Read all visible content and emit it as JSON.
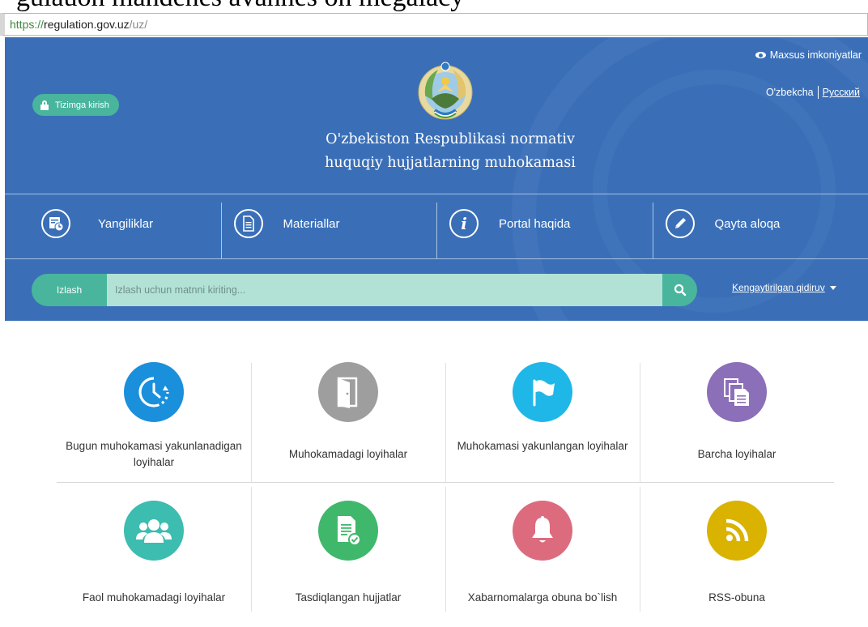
{
  "browser": {
    "partial_title": "guiauon mandenes avannes on megalacy",
    "url_proto": "https://",
    "url_host": "regulation.gov.uz",
    "url_path": "/uz/"
  },
  "header": {
    "login_label": "Tizimga kirish",
    "accessibility_label": "Maxsus imkoniyatlar",
    "lang_uz": "O'zbekcha",
    "lang_ru": "Русский",
    "title_line1": "O'zbekiston Respublikasi normativ",
    "title_line2": "huquqiy hujjatlarning muhokamasi"
  },
  "nav": [
    {
      "label": "Yangiliklar",
      "icon": "news-calendar-icon"
    },
    {
      "label": "Materiallar",
      "icon": "document-icon"
    },
    {
      "label": "Portal haqida",
      "icon": "info-icon"
    },
    {
      "label": "Qayta aloqa",
      "icon": "pencil-icon"
    }
  ],
  "search": {
    "label": "Izlash",
    "placeholder": "Izlash uchun matnni kiriting...",
    "advanced_label": "Kengaytirilgan qidiruv"
  },
  "tiles": [
    {
      "label": "Bugun muhokamasi yakunlanadigan loyihalar",
      "icon": "clock-arrow-icon",
      "color": "#1a8fdb"
    },
    {
      "label": "Muhokamadagi loyihalar",
      "icon": "door-icon",
      "color": "#9e9e9e"
    },
    {
      "label": "Muhokamasi yakunlangan loyihalar",
      "icon": "flag-icon",
      "color": "#1fb6e8"
    },
    {
      "label": "Barcha loyihalar",
      "icon": "documents-stack-icon",
      "color": "#8b6fb8"
    },
    {
      "label": "Faol muhokamadagi loyihalar",
      "icon": "users-icon",
      "color": "#3dbcb0"
    },
    {
      "label": "Tasdiqlangan hujjatlar",
      "icon": "approved-document-icon",
      "color": "#3fb86b"
    },
    {
      "label": "Xabarnomalarga obuna bo`lish",
      "icon": "bell-icon",
      "color": "#dd6b7e"
    },
    {
      "label": "RSS-obuna",
      "icon": "rss-icon",
      "color": "#d9b300"
    }
  ],
  "colors": {
    "header_bg": "#3a6fb8",
    "accent_green": "#49b59d",
    "search_field": "#b2e2d6"
  }
}
